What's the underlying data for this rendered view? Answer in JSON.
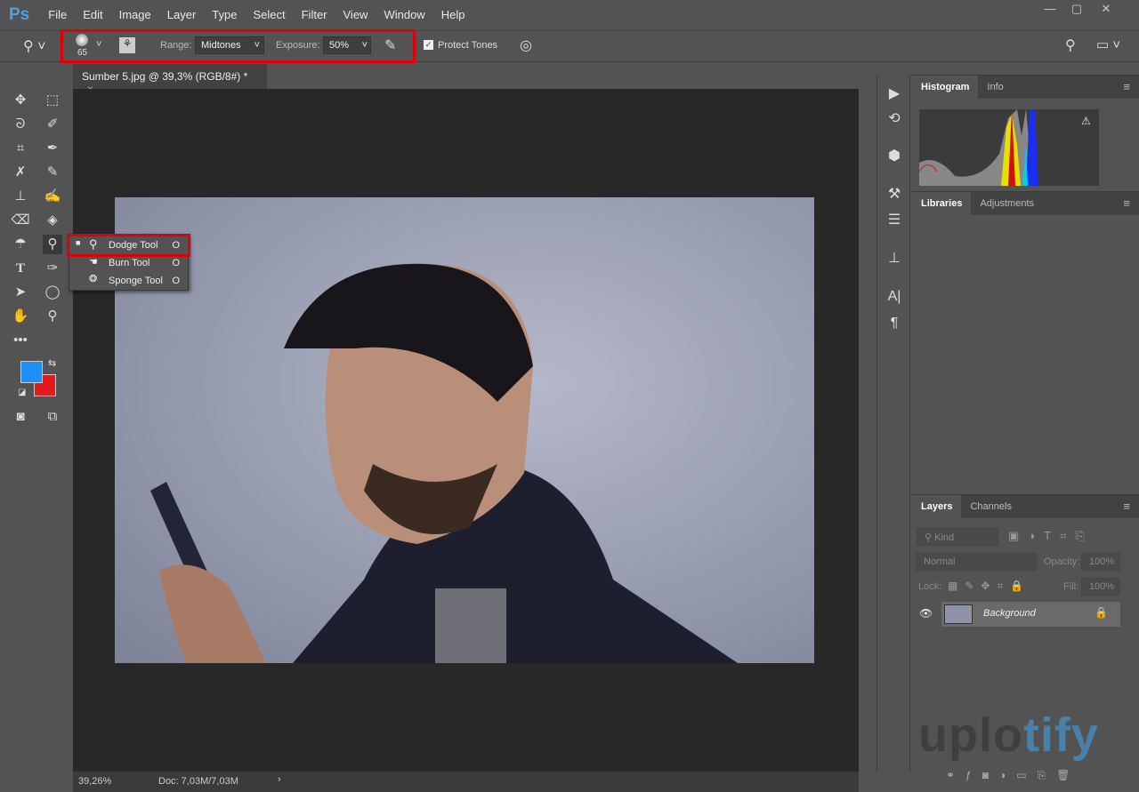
{
  "app": {
    "logo": "Ps",
    "menu": [
      "File",
      "Edit",
      "Image",
      "Layer",
      "Type",
      "Select",
      "Filter",
      "View",
      "Window",
      "Help"
    ],
    "window_controls": [
      "—",
      "▢",
      "✕"
    ]
  },
  "options": {
    "brush_size": "65",
    "range_label": "Range:",
    "range_value": "Midtones",
    "exposure_label": "Exposure:",
    "exposure_value": "50%",
    "protect_tones_label": "Protect Tones",
    "protect_tones_checked": true
  },
  "document": {
    "tab_title": "Sumber 5.jpg @ 39,3% (RGB/8#) *",
    "close": "×",
    "zoom": "39,26%",
    "doc_info": "Doc: 7,03M/7,03M",
    "status_arrow": "›"
  },
  "flyout": {
    "items": [
      {
        "label": "Dodge Tool",
        "key": "O",
        "selected": true
      },
      {
        "label": "Burn Tool",
        "key": "O",
        "selected": false
      },
      {
        "label": "Sponge Tool",
        "key": "O",
        "selected": false
      }
    ]
  },
  "colors": {
    "foreground": "#1e8ff5",
    "background": "#e01b1b",
    "highlight": "#e0000a"
  },
  "panels": {
    "histogram": {
      "tabs": [
        "Histogram",
        "Info"
      ],
      "warning": "⚠"
    },
    "libraries": {
      "tabs": [
        "Libraries",
        "Adjustments"
      ]
    },
    "layers": {
      "tabs": [
        "Layers",
        "Channels"
      ],
      "kind": "Kind",
      "blend_mode": "Normal",
      "opacity_label": "Opacity:",
      "opacity_value": "100%",
      "lock_label": "Lock:",
      "fill_label": "Fill:",
      "fill_value": "100%",
      "layer_name": "Background"
    }
  },
  "watermark": "uplotify"
}
